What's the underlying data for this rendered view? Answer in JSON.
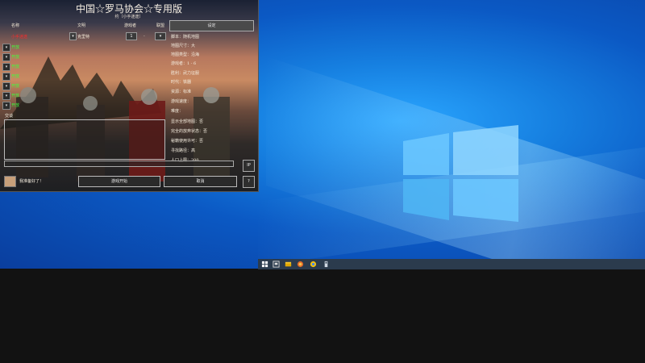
{
  "game": {
    "title": "中国☆罗马协会☆专用版",
    "subtitle": "约〔小手迷途〕",
    "headers": {
      "name": "名称",
      "civ": "文明",
      "team": "游戏者",
      "group": "联盟"
    },
    "player": {
      "name": "小手迷途",
      "civ": "克里特",
      "team_value": "1",
      "group_value": "-"
    },
    "open_label": "开放",
    "open_slots": [
      "开放",
      "开放",
      "开放",
      "开放",
      "开放",
      "开放",
      "开放"
    ],
    "settings_button": "设定",
    "settings": [
      "脚本：随机地图",
      "地图尺寸：大",
      "地图类型：沿海",
      "游戏者：1 - 6",
      "胜利：武力征服",
      "时代：铁器",
      "资源：标准",
      "游戏速度：",
      "难度：",
      "显示全部地图：否",
      "完全的放弃状态：否",
      "秘籍使用许可：否",
      "寻找路径：高",
      "人口上限：200"
    ],
    "chat_label": "交谈",
    "ip_button": "IP",
    "ready_label": "我准备好了！",
    "start_button": "游戏开始",
    "cancel_button": "取消",
    "help_button": "?"
  },
  "colors": {
    "player_name": "#ff2a2a",
    "open_slot": "#3cff3c",
    "taskbar": "#2b3b4d",
    "desktop_accent": "#1a86e8"
  },
  "taskbar": {
    "icons": [
      "windows-start-icon",
      "search-icon",
      "file-explorer-icon",
      "game-app-icon",
      "chrome-icon",
      "pinned-app-icon"
    ]
  }
}
